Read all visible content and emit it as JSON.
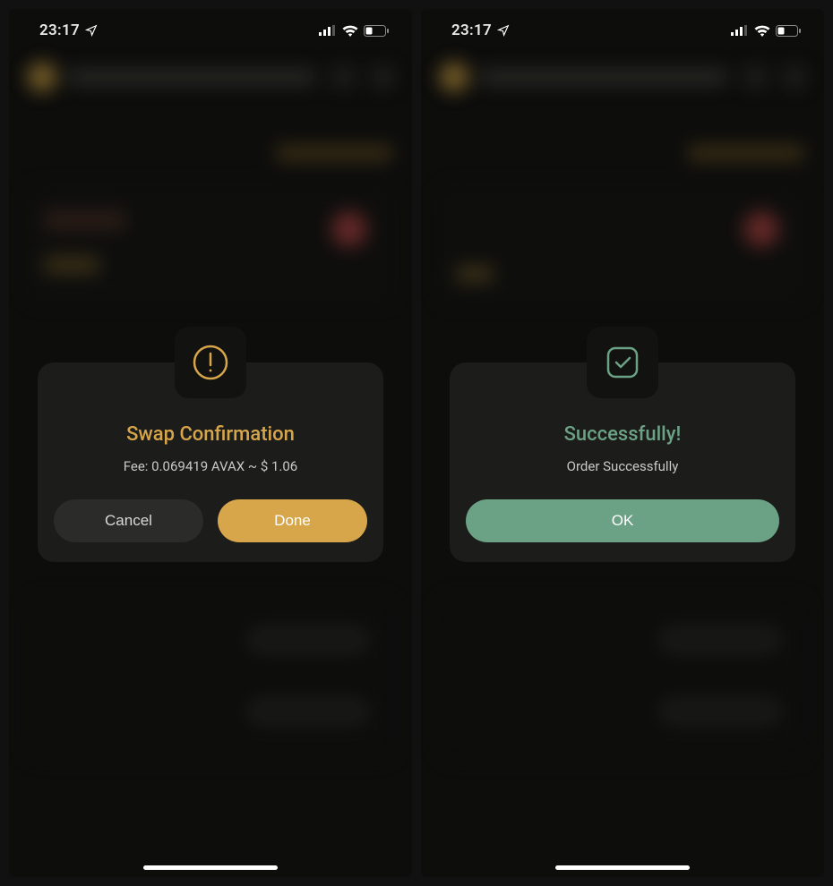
{
  "status": {
    "time": "23:17"
  },
  "left_modal": {
    "title": "Swap Confirmation",
    "fee_line": "Fee: 0.069419 AVAX ~ $ 1.06",
    "cancel_label": "Cancel",
    "done_label": "Done"
  },
  "right_modal": {
    "title": "Successfully!",
    "message": "Order Successfully",
    "ok_label": "OK"
  },
  "colors": {
    "gold": "#d7a64b",
    "green": "#6ba184"
  }
}
